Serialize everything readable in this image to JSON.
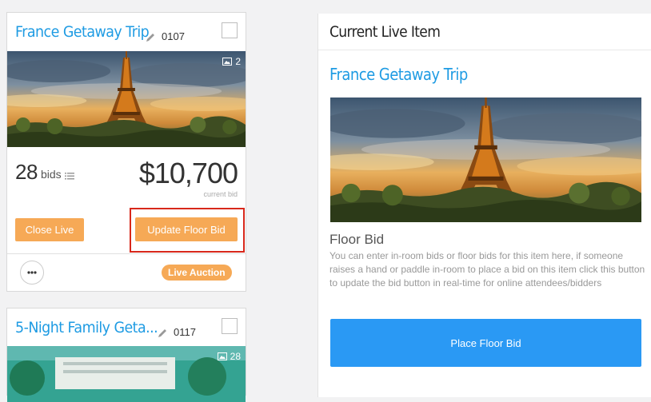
{
  "cards": [
    {
      "title": "France Getaway Trip",
      "lot_number": "0107",
      "image_count": "2",
      "bids_count": "28",
      "bids_word": "bids",
      "amount": "$10,700",
      "amount_caption": "current bid",
      "close_live_label": "Close Live",
      "update_floor_label": "Update Floor Bid",
      "status_badge": "Live Auction"
    },
    {
      "title": "5-Night Family Geta...",
      "lot_number": "0117",
      "image_count": "28"
    }
  ],
  "live_panel": {
    "header": "Current Live Item",
    "item_title": "France Getaway Trip",
    "floor_bid_heading": "Floor Bid",
    "floor_bid_description": "You can enter in-room bids or floor bids for this item here, if someone raises a hand or paddle in-room to place a bid on this item click this button to update the bid button in real-time for online attendees/bidders",
    "place_bid_label": "Place Floor Bid"
  },
  "colors": {
    "title_blue": "#1e9be3",
    "orange": "#f6a956",
    "highlight_red": "#d8281b",
    "button_blue": "#2a99f4"
  },
  "icons": [
    "pencil-icon",
    "image-icon",
    "list-icon",
    "more-icon"
  ]
}
